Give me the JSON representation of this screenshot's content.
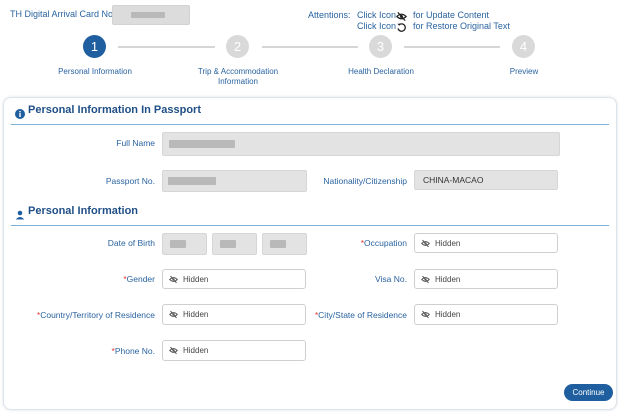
{
  "header": {
    "card_label": "TH Digital Arrival Card No.",
    "attentions_label": "Attentions:",
    "click_icon_1": "Click Icon",
    "update_text": "for Update Content",
    "click_icon_2": "Click Icon",
    "restore_text": "for Restore Original Text"
  },
  "steps": [
    {
      "number": "1",
      "label": "Personal Information",
      "active": true
    },
    {
      "number": "2",
      "label": "Trip & Accommodation Information",
      "active": false
    },
    {
      "number": "3",
      "label": "Health Declaration",
      "active": false
    },
    {
      "number": "4",
      "label": "Preview",
      "active": false
    }
  ],
  "passport_section": {
    "title": "Personal Information In Passport",
    "full_name_label": "Full Name",
    "passport_no_label": "Passport No.",
    "nationality_label": "Nationality/Citizenship",
    "nationality_value": "CHINA-MACAO"
  },
  "personal_section": {
    "title": "Personal Information",
    "dob_label": "Date of Birth",
    "occupation_label": "Occupation",
    "gender_label": "Gender",
    "visa_label": "Visa No.",
    "country_label": "Country/Territory of Residence",
    "city_label": "City/State of Residence",
    "phone_label": "Phone No.",
    "required_mark": "*",
    "hidden_text": "Hidden"
  },
  "continue_label": "Continue",
  "colors": {
    "accent": "#1f5fa0",
    "required": "#e53935",
    "label": "#2a63a0"
  },
  "icons": [
    "info-icon",
    "person-icon",
    "eye-off-icon",
    "restore-icon"
  ]
}
